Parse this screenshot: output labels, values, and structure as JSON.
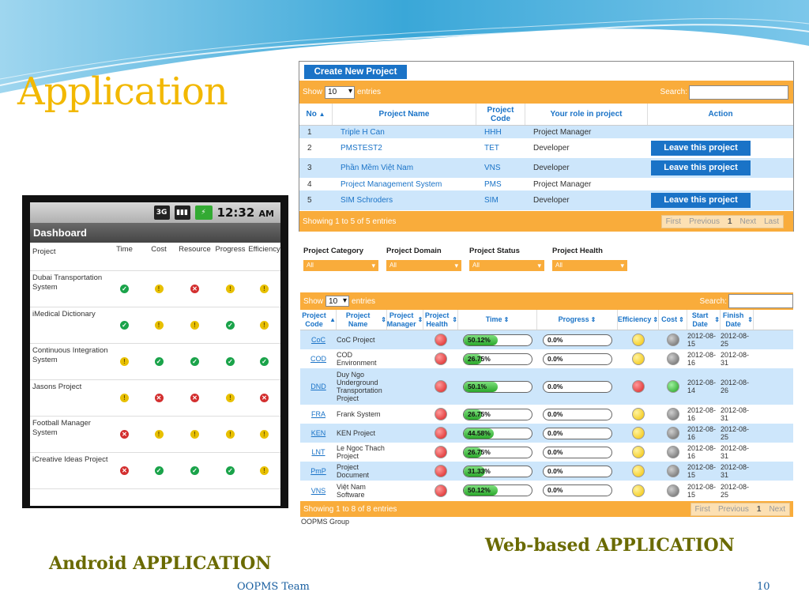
{
  "slide": {
    "title": "Application",
    "footer_team": "OOPMS Team",
    "page_num": "10",
    "android_caption": "Android APPLICATION",
    "web_caption": "Web-based APPLICATION"
  },
  "android": {
    "status": {
      "net": "3G",
      "time": "12:32",
      "ampm": "AM"
    },
    "title": "Dashboard",
    "columns": [
      "Project",
      "Time",
      "Cost",
      "Resource",
      "Progress",
      "Efficiency"
    ],
    "rows": [
      {
        "name": "Dubai Transportation System",
        "s": [
          "ok",
          "warn",
          "err",
          "warn",
          "warn"
        ]
      },
      {
        "name": "iMedical Dictionary",
        "s": [
          "ok",
          "warn",
          "warn",
          "ok",
          "warn"
        ]
      },
      {
        "name": "Continuous Integration System",
        "s": [
          "warn",
          "ok",
          "ok",
          "ok",
          "ok"
        ]
      },
      {
        "name": "Jasons Project",
        "s": [
          "warn",
          "err",
          "err",
          "warn",
          "err"
        ]
      },
      {
        "name": "Football Manager System",
        "s": [
          "err",
          "warn",
          "warn",
          "warn",
          "warn"
        ]
      },
      {
        "name": "iCreative Ideas Project",
        "s": [
          "err",
          "ok",
          "ok",
          "ok",
          "warn"
        ]
      }
    ]
  },
  "web1": {
    "create_btn": "Create New Project",
    "show": "Show",
    "entries": "entries",
    "show_val": "10",
    "search": "Search:",
    "columns": [
      "No",
      "Project Name",
      "Project Code",
      "Your role in project",
      "Action"
    ],
    "leave": "Leave this project",
    "rows": [
      {
        "no": "1",
        "name": "Triple H Can",
        "code": "HHH",
        "role": "Project Manager",
        "leave": false
      },
      {
        "no": "2",
        "name": "PMSTEST2",
        "code": "TET",
        "role": "Developer",
        "leave": true
      },
      {
        "no": "3",
        "name": "Phần Mềm Việt Nam",
        "code": "VNS",
        "role": "Developer",
        "leave": true
      },
      {
        "no": "4",
        "name": "Project Management System",
        "code": "PMS",
        "role": "Project Manager",
        "leave": false
      },
      {
        "no": "5",
        "name": "SIM Schroders",
        "code": "SIM",
        "role": "Developer",
        "leave": true
      }
    ],
    "info": "Showing 1 to 5 of 5 entries",
    "pager": [
      "First",
      "Previous",
      "1",
      "Next",
      "Last"
    ]
  },
  "web2": {
    "filters": [
      {
        "label": "Project Category",
        "value": "All"
      },
      {
        "label": "Project Domain",
        "value": "All"
      },
      {
        "label": "Project Status",
        "value": "All"
      },
      {
        "label": "Project Health",
        "value": "All"
      }
    ],
    "show": "Show",
    "entries": "entries",
    "show_val": "10",
    "search": "Search:",
    "columns": [
      "Project Code",
      "Project Name",
      "Project Manager",
      "Project Health",
      "Time",
      "Progress",
      "Efficiency",
      "Cost",
      "Start Date",
      "Finish Date"
    ],
    "rows": [
      {
        "code": "CoC",
        "name": "CoC Project",
        "health": "red",
        "time": "50.12%",
        "tp": 0.5012,
        "prog": "0.0%",
        "eff": "yel",
        "cost": "gry",
        "start": "2012-08-15",
        "finish": "2012-08-25"
      },
      {
        "code": "COD",
        "name": "COD Environment",
        "health": "red",
        "time": "26.75%",
        "tp": 0.2675,
        "prog": "0.0%",
        "eff": "yel",
        "cost": "gry",
        "start": "2012-08-16",
        "finish": "2012-08-31"
      },
      {
        "code": "DND",
        "name": "Duy Ngo Underground Transportation Project",
        "health": "red",
        "time": "50.1%",
        "tp": 0.501,
        "prog": "0.0%",
        "eff": "red",
        "cost": "grn",
        "start": "2012-08-14",
        "finish": "2012-08-26"
      },
      {
        "code": "FRA",
        "name": "Frank System",
        "health": "red",
        "time": "26.75%",
        "tp": 0.2675,
        "prog": "0.0%",
        "eff": "yel",
        "cost": "gry",
        "start": "2012-08-16",
        "finish": "2012-08-31"
      },
      {
        "code": "KEN",
        "name": "KEN Project",
        "health": "red",
        "time": "44.58%",
        "tp": 0.4458,
        "prog": "0.0%",
        "eff": "yel",
        "cost": "gry",
        "start": "2012-08-16",
        "finish": "2012-08-25"
      },
      {
        "code": "LNT",
        "name": "Le Ngoc Thach Project",
        "health": "red",
        "time": "26.75%",
        "tp": 0.2675,
        "prog": "0.0%",
        "eff": "yel",
        "cost": "gry",
        "start": "2012-08-16",
        "finish": "2012-08-31"
      },
      {
        "code": "PmP",
        "name": "Project Document",
        "health": "red",
        "time": "31.33%",
        "tp": 0.3133,
        "prog": "0.0%",
        "eff": "yel",
        "cost": "gry",
        "start": "2012-08-15",
        "finish": "2012-08-31"
      },
      {
        "code": "VNS",
        "name": "Việt Nam Software",
        "health": "red",
        "time": "50.12%",
        "tp": 0.5012,
        "prog": "0.0%",
        "eff": "yel",
        "cost": "gry",
        "start": "2012-08-15",
        "finish": "2012-08-25"
      }
    ],
    "info": "Showing 1 to 8 of 8 entries",
    "pager": [
      "First",
      "Previous",
      "1",
      "Next"
    ],
    "group": "OOPMS Group"
  }
}
